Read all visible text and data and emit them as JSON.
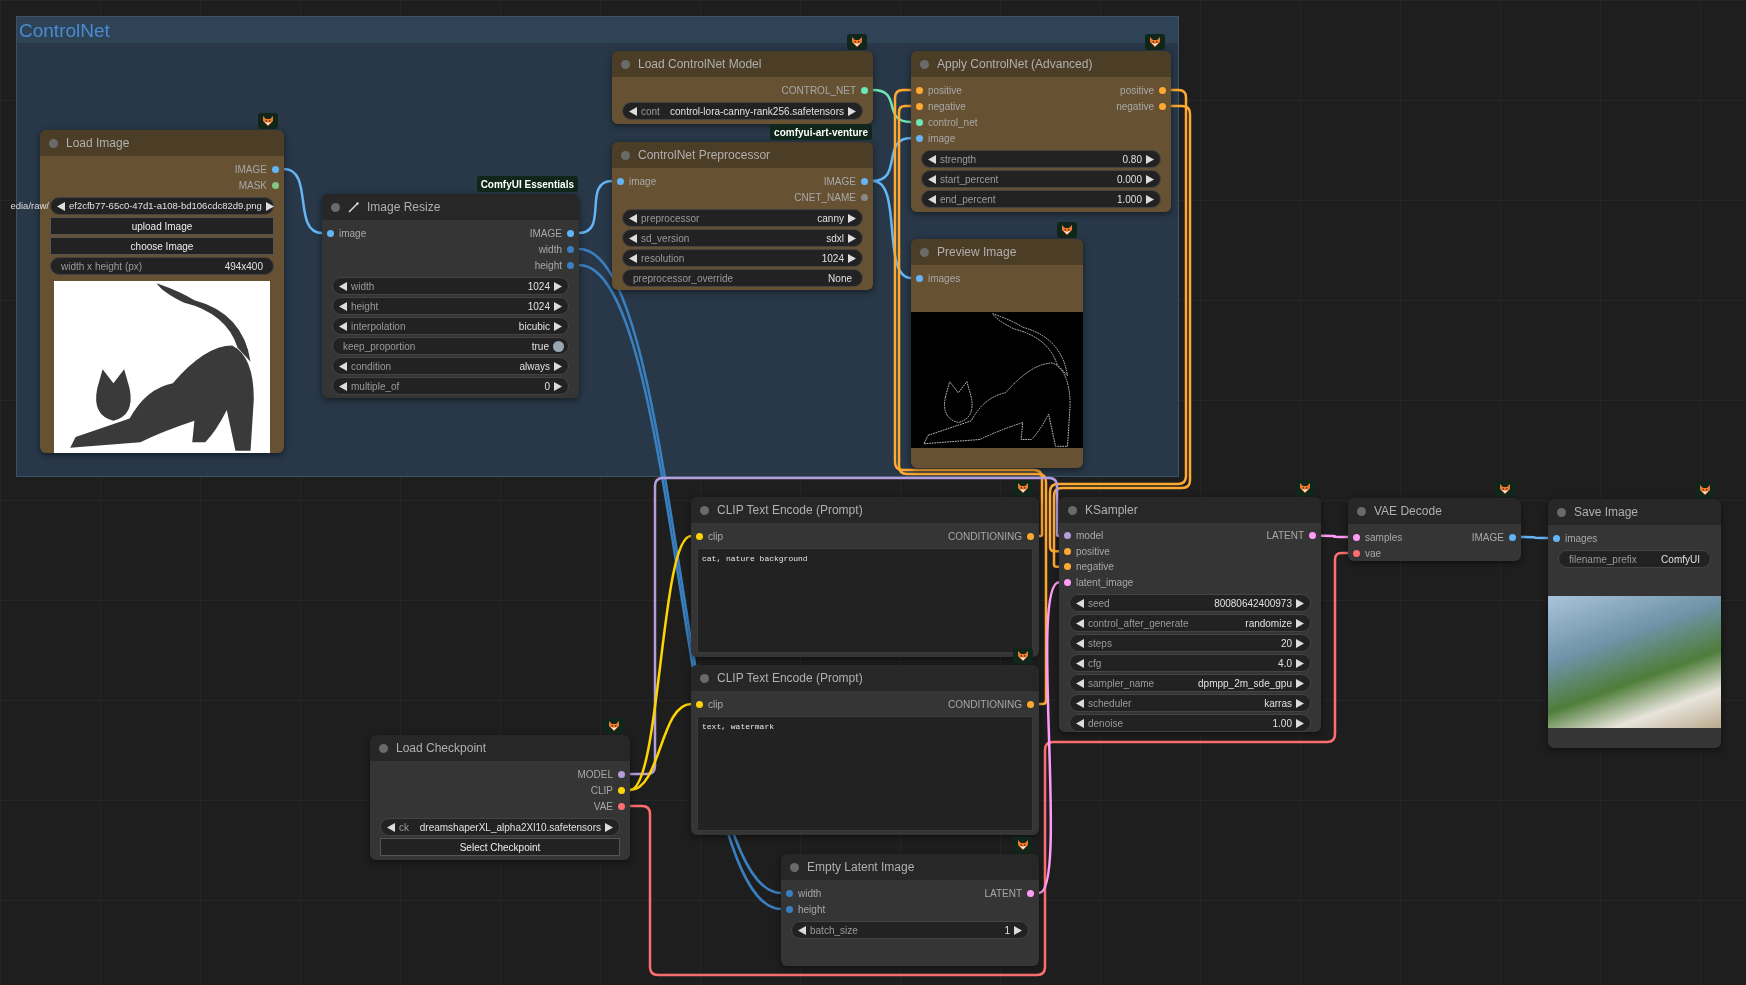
{
  "group": {
    "title": "ControlNet"
  },
  "nodes": [
    {
      "title": "Load Image",
      "color": "#665233",
      "outputs": [
        {
          "label": "IMAGE",
          "color": "#64b5f6"
        },
        {
          "label": "MASK",
          "color": "#81c784"
        }
      ],
      "widgets": [
        {
          "kind": "path",
          "label": "edia/raw/",
          "value": "ef2cfb77-65c0-47d1-a108-bd106cdc82d9.png"
        },
        {
          "kind": "button",
          "label": "upload Image"
        },
        {
          "kind": "button",
          "label": "choose Image"
        },
        {
          "kind": "text",
          "label": "width x height (px)",
          "value": "494x400"
        }
      ],
      "preview": {
        "kind": "line-drawing"
      }
    },
    {
      "title": "Image Resize",
      "color": "#353535",
      "badge": "ComfyUI Essentials",
      "has_icon": true,
      "inputs": [
        {
          "label": "image",
          "color": "#64b5f6"
        }
      ],
      "outputs": [
        {
          "label": "IMAGE",
          "color": "#64b5f6"
        },
        {
          "label": "width",
          "color": "#3a7fc0"
        },
        {
          "label": "height",
          "color": "#3a7fc0"
        }
      ],
      "widgets": [
        {
          "kind": "combo",
          "label": "width",
          "value": "1024"
        },
        {
          "kind": "combo",
          "label": "height",
          "value": "1024"
        },
        {
          "kind": "combo",
          "label": "interpolation",
          "value": "bicubic"
        },
        {
          "kind": "toggle",
          "label": "keep_proportion",
          "value": "true",
          "on": true
        },
        {
          "kind": "combo",
          "label": "condition",
          "value": "always"
        },
        {
          "kind": "combo",
          "label": "multiple_of",
          "value": "0"
        }
      ]
    },
    {
      "title": "Load ControlNet Model",
      "color": "#665233",
      "outputs": [
        {
          "label": "CONTROL_NET",
          "color": "#6ee7b7"
        }
      ],
      "widgets": [
        {
          "kind": "combo",
          "label": "cont",
          "value": "control-lora-canny-rank256.safetensors"
        }
      ]
    },
    {
      "title": "ControlNet Preprocessor",
      "color": "#665233",
      "badge": "comfyui-art-venture",
      "inputs": [
        {
          "label": "image",
          "color": "#64b5f6"
        }
      ],
      "outputs": [
        {
          "label": "IMAGE",
          "color": "#64b5f6"
        },
        {
          "label": "CNET_NAME",
          "color": "#888888"
        }
      ],
      "widgets": [
        {
          "kind": "combo",
          "label": "preprocessor",
          "value": "canny"
        },
        {
          "kind": "combo",
          "label": "sd_version",
          "value": "sdxl"
        },
        {
          "kind": "combo",
          "label": "resolution",
          "value": "1024"
        },
        {
          "kind": "text",
          "label": "preprocessor_override",
          "value": "None"
        }
      ]
    },
    {
      "title": "Apply ControlNet (Advanced)",
      "color": "#665233",
      "inputs": [
        {
          "label": "positive",
          "color": "#ffa931"
        },
        {
          "label": "negative",
          "color": "#ffa931"
        },
        {
          "label": "control_net",
          "color": "#6ee7b7"
        },
        {
          "label": "image",
          "color": "#64b5f6"
        }
      ],
      "outputs": [
        {
          "label": "positive",
          "color": "#ffa931"
        },
        {
          "label": "negative",
          "color": "#ffa931"
        }
      ],
      "widgets": [
        {
          "kind": "combo",
          "label": "strength",
          "value": "0.80"
        },
        {
          "kind": "combo",
          "label": "start_percent",
          "value": "0.000"
        },
        {
          "kind": "combo",
          "label": "end_percent",
          "value": "1.000"
        }
      ]
    },
    {
      "title": "Preview Image",
      "color": "#665233",
      "inputs": [
        {
          "label": "images",
          "color": "#64b5f6"
        }
      ],
      "preview": {
        "kind": "edge-map"
      }
    },
    {
      "title": "CLIP Text Encode (Prompt)",
      "color": "#353535",
      "inputs": [
        {
          "label": "clip",
          "color": "#ffd500"
        }
      ],
      "outputs": [
        {
          "label": "CONDITIONING",
          "color": "#ffa931"
        }
      ],
      "widgets": [
        {
          "kind": "textarea",
          "value": "cat, nature background"
        }
      ]
    },
    {
      "title": "CLIP Text Encode (Prompt)",
      "color": "#353535",
      "inputs": [
        {
          "label": "clip",
          "color": "#ffd500"
        }
      ],
      "outputs": [
        {
          "label": "CONDITIONING",
          "color": "#ffa931"
        }
      ],
      "widgets": [
        {
          "kind": "textarea",
          "value": "text, watermark"
        }
      ]
    },
    {
      "title": "KSampler",
      "color": "#353535",
      "inputs": [
        {
          "label": "model",
          "color": "#b39ddb"
        },
        {
          "label": "positive",
          "color": "#ffa931"
        },
        {
          "label": "negative",
          "color": "#ffa931"
        },
        {
          "label": "latent_image",
          "color": "#ff9cf9"
        }
      ],
      "outputs": [
        {
          "label": "LATENT",
          "color": "#ff9cf9"
        }
      ],
      "widgets": [
        {
          "kind": "combo",
          "label": "seed",
          "value": "80080642400973"
        },
        {
          "kind": "combo",
          "label": "control_after_generate",
          "value": "randomize"
        },
        {
          "kind": "combo",
          "label": "steps",
          "value": "20"
        },
        {
          "kind": "combo",
          "label": "cfg",
          "value": "4.0"
        },
        {
          "kind": "combo",
          "label": "sampler_name",
          "value": "dpmpp_2m_sde_gpu"
        },
        {
          "kind": "combo",
          "label": "scheduler",
          "value": "karras"
        },
        {
          "kind": "combo",
          "label": "denoise",
          "value": "1.00"
        }
      ]
    },
    {
      "title": "VAE Decode",
      "color": "#353535",
      "inputs": [
        {
          "label": "samples",
          "color": "#ff9cf9"
        },
        {
          "label": "vae",
          "color": "#ff6e6e"
        }
      ],
      "outputs": [
        {
          "label": "IMAGE",
          "color": "#64b5f6"
        }
      ]
    },
    {
      "title": "Save Image",
      "color": "#353535",
      "inputs": [
        {
          "label": "images",
          "color": "#64b5f6"
        }
      ],
      "widgets": [
        {
          "kind": "text",
          "label": "filename_prefix",
          "value": "ComfyUI"
        }
      ],
      "preview": {
        "kind": "photo"
      }
    },
    {
      "title": "Load Checkpoint",
      "color": "#353535",
      "outputs": [
        {
          "label": "MODEL",
          "color": "#b39ddb"
        },
        {
          "label": "CLIP",
          "color": "#ffd500"
        },
        {
          "label": "VAE",
          "color": "#ff6e6e"
        }
      ],
      "widgets": [
        {
          "kind": "combo",
          "label": "ck",
          "value": "dreamshaperXL_alpha2Xl10.safetensors"
        },
        {
          "kind": "button",
          "label": "Select Checkpoint"
        }
      ]
    },
    {
      "title": "Empty Latent Image",
      "color": "#353535",
      "inputs": [
        {
          "label": "width",
          "color": "#3a7fc0"
        },
        {
          "label": "height",
          "color": "#3a7fc0"
        }
      ],
      "outputs": [
        {
          "label": "LATENT",
          "color": "#ff9cf9"
        }
      ],
      "widgets": [
        {
          "kind": "combo",
          "label": "batch_size",
          "value": "1"
        }
      ]
    }
  ]
}
